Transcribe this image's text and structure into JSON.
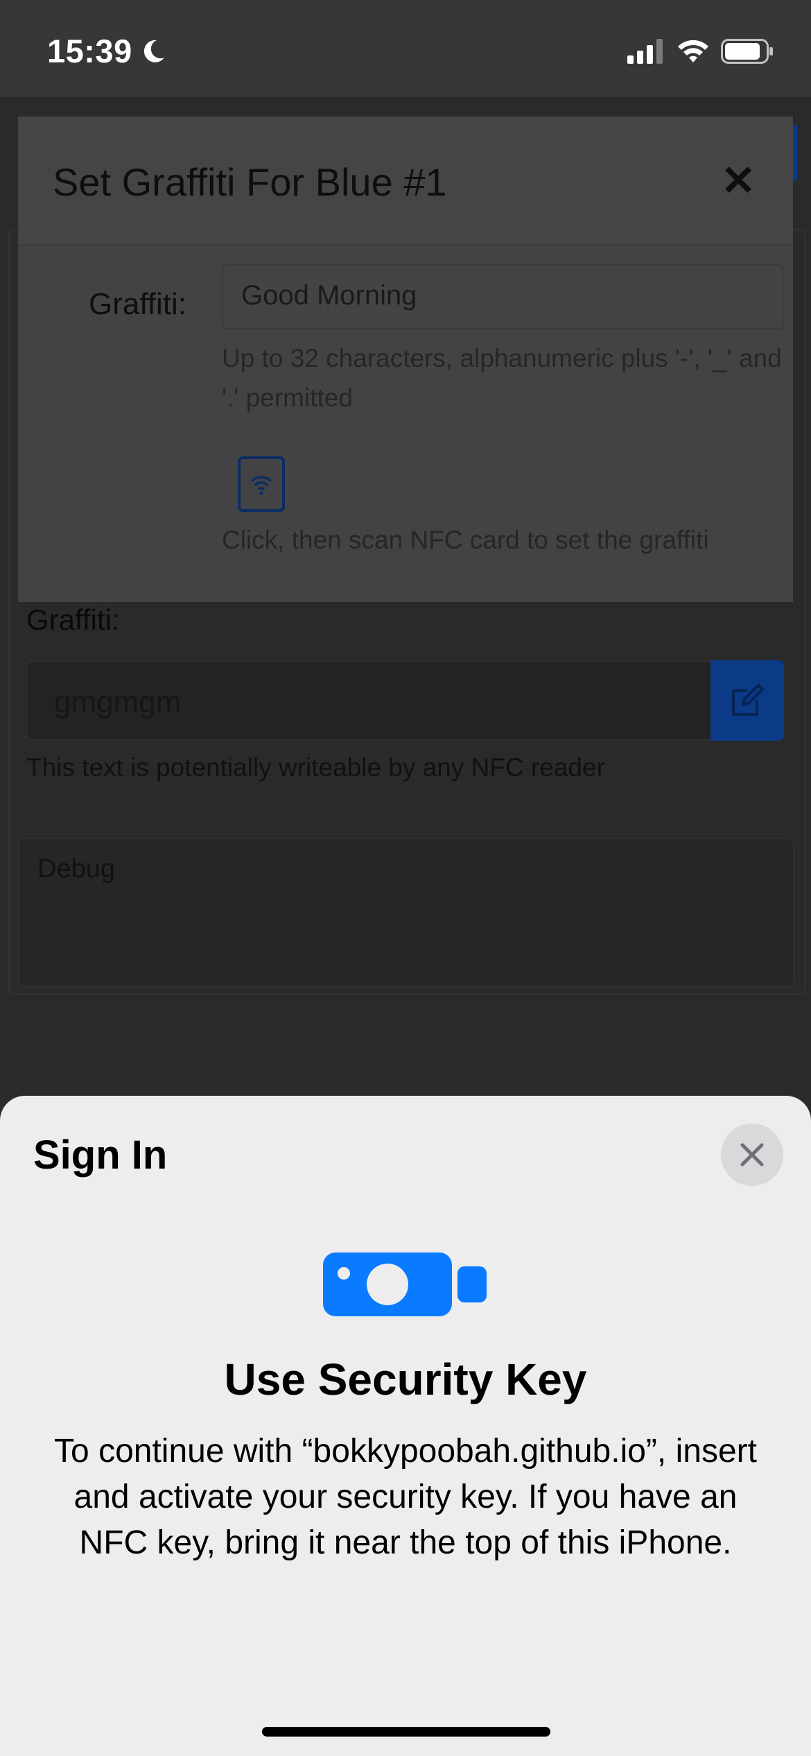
{
  "status_bar": {
    "time": "15:39",
    "icons": [
      "moon-icon",
      "cellular-signal-icon",
      "wifi-icon",
      "battery-icon"
    ]
  },
  "modal": {
    "title": "Set Graffiti For Blue #1",
    "close_symbol": "✕",
    "field_label": "Graffiti:",
    "input_value": "Good Morning",
    "help_text": "Up to 32 characters, alphanumeric plus '-', '_' and '.' permitted",
    "nfc_instruction": "Click, then scan NFC card to set the graffiti"
  },
  "background_page": {
    "graffiti_label": "Graffiti:",
    "graffiti_value": "gmgmgm",
    "nfc_hint": "This text is potentially writeable by any NFC reader",
    "debug_label": "Debug"
  },
  "sheet": {
    "title": "Sign In",
    "heading": "Use Security Key",
    "description": "To continue with “bokkypoobah.github.io”, insert and activate your security key. If you have an NFC key, bring it near the top of this iPhone."
  },
  "colors": {
    "accent": "#0a7aff",
    "sheet_bg": "#ededee",
    "overlay_bg": "#2b2b2c"
  }
}
